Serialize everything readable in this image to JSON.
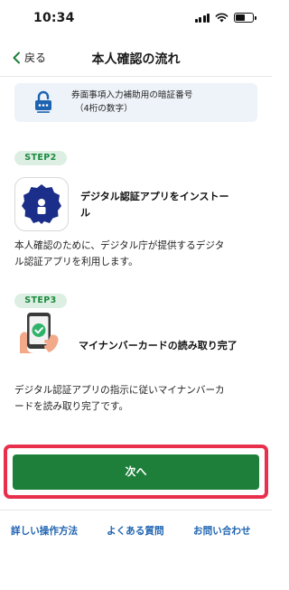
{
  "status_bar": {
    "time": "10:34",
    "icons": [
      "signal-icon",
      "wifi-icon",
      "battery-icon"
    ]
  },
  "nav": {
    "back_label": "戻る",
    "title": "本人確認の流れ"
  },
  "pin_card": {
    "icon": "padlock-icon",
    "line1": "券面事項入力補助用の暗証番号",
    "line2": "（4桁の数字）"
  },
  "step2": {
    "badge": "STEP2",
    "icon": "digital-auth-app-icon",
    "title_line1": "デジタル認証アプリをインストー",
    "title_line2": "ル",
    "desc_line1": "本人確認のために、デジタル庁が提供するデジタ",
    "desc_line2": "ル認証アプリを利用します。"
  },
  "step3": {
    "badge": "STEP3",
    "icon": "phone-check-icon",
    "title": "マイナンバーカードの読み取り完了",
    "desc_line1": "デジタル認証アプリの指示に従いマイナンバーカ",
    "desc_line2": "ードを読み取り完了です。"
  },
  "next_button": {
    "label": "次へ"
  },
  "footer": {
    "links": [
      "詳しい操作方法",
      "よくある質問",
      "お問い合わせ"
    ]
  },
  "colors": {
    "primary_green": "#1d7f3a",
    "step_badge_bg": "#dcefe2",
    "step_badge_text": "#1b8a40",
    "highlight_red": "#e8304d",
    "link_blue": "#1e63b0",
    "app_icon_navy": "#1a2e8a"
  }
}
